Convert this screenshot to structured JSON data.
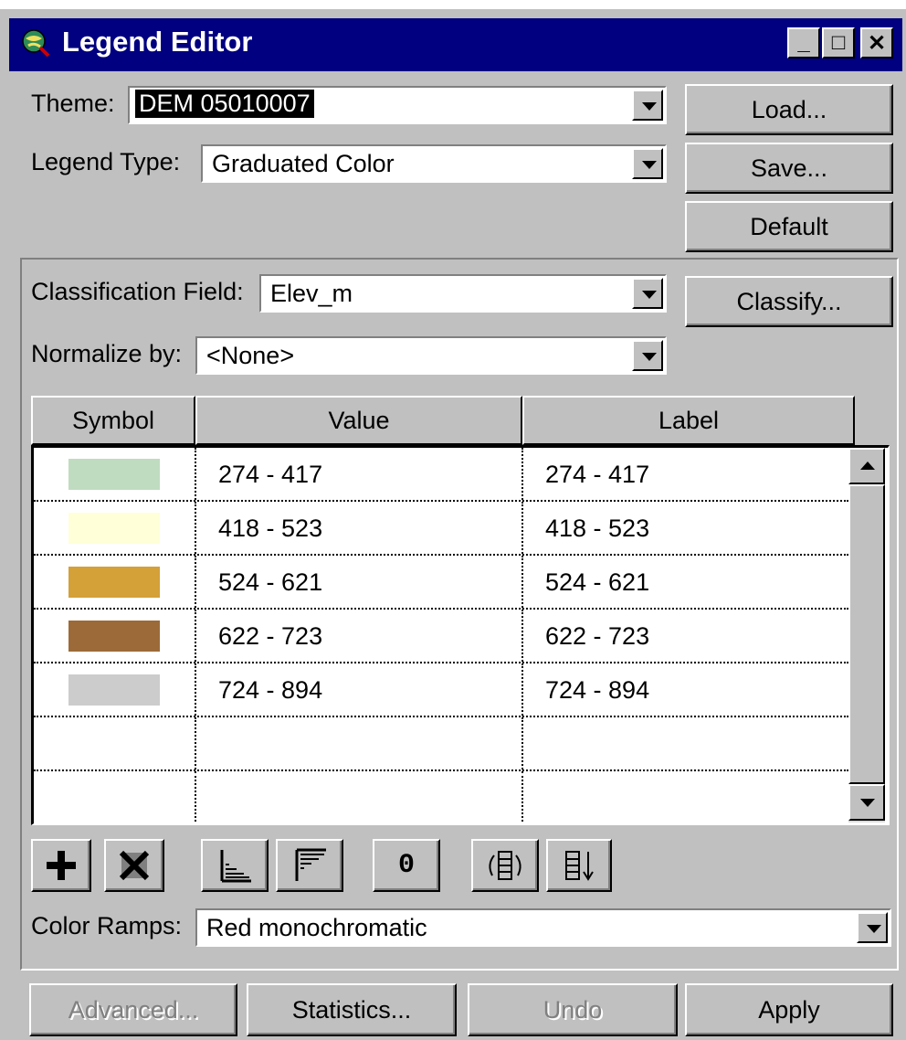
{
  "window": {
    "title": "Legend Editor",
    "minimize_glyph": "_",
    "maximize_glyph": "□",
    "close_glyph": "✕"
  },
  "theme": {
    "label": "Theme:",
    "value": "DEM 05010007"
  },
  "legend_type": {
    "label": "Legend Type:",
    "value": "Graduated Color"
  },
  "buttons": {
    "load": "Load...",
    "save": "Save...",
    "default": "Default",
    "classify": "Classify..."
  },
  "classification_field": {
    "label": "Classification Field:",
    "value": "Elev_m"
  },
  "normalize_by": {
    "label": "Normalize by:",
    "value": "<None>"
  },
  "table": {
    "headers": {
      "symbol": "Symbol",
      "value": "Value",
      "label": "Label"
    },
    "rows": [
      {
        "color": "#c0dcc0",
        "value": "274 - 417",
        "label": "274 - 417"
      },
      {
        "color": "#ffffd8",
        "value": "418 - 523",
        "label": "418 - 523"
      },
      {
        "color": "#d4a038",
        "value": "524 - 621",
        "label": "524 - 621"
      },
      {
        "color": "#9c6a38",
        "value": "622 - 723",
        "label": "622 - 723"
      },
      {
        "color": "#cccccc",
        "value": "724 - 894",
        "label": "724 - 894"
      }
    ]
  },
  "toolbar": {
    "add_icon": "plus-icon",
    "delete_icon": "delete-icon",
    "sort_ascending_icon": "sort-ascending-icon",
    "sort_descending_icon": "sort-descending-icon",
    "null_value_label": "0",
    "flip_icon": "flip-symbols-icon",
    "sort_order_icon": "sort-order-icon"
  },
  "color_ramps": {
    "label": "Color Ramps:",
    "value": "Red monochromatic"
  },
  "bottom_buttons": {
    "advanced": "Advanced...",
    "statistics": "Statistics...",
    "undo": "Undo",
    "apply": "Apply"
  }
}
